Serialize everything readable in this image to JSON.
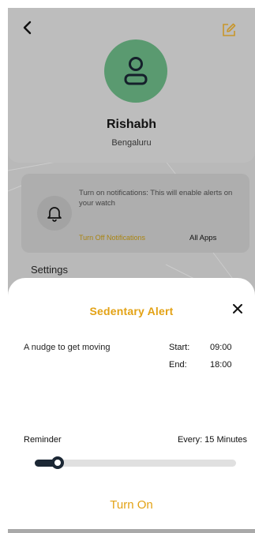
{
  "profile": {
    "name": "Rishabh",
    "city": "Bengaluru"
  },
  "notification_card": {
    "text": "Turn on notifications: This will enable alerts on your watch",
    "action_label": "Turn Off Notifications",
    "apps_label": "All Apps"
  },
  "settings_label": "Settings",
  "sheet": {
    "title": "Sedentary Alert",
    "description": "A nudge to get moving",
    "start_label": "Start:",
    "start_value": "09:00",
    "end_label": "End:",
    "end_value": "18:00",
    "reminder_label": "Reminder",
    "reminder_value": "Every: 15 Minutes",
    "slider_level": 0.09,
    "button_label": "Turn On"
  },
  "colors": {
    "accent": "#e3a215",
    "avatar": "#5a9a70",
    "slider": "#1b2734"
  }
}
